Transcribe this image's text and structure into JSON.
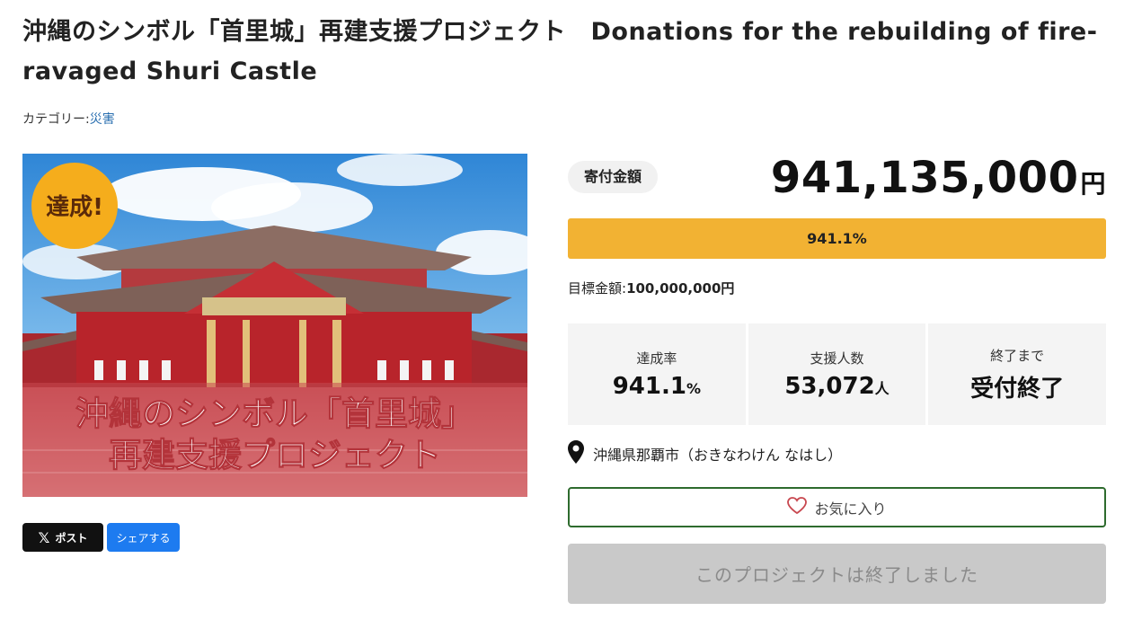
{
  "page": {
    "title": "沖縄のシンボル「首里城」再建支援プロジェクト　Donations for the rebuilding of fire-ravaged Shuri Castle",
    "category_label": "カテゴリー:",
    "category_value": "災害"
  },
  "hero": {
    "badge": "達成!",
    "caption_line1": "沖縄のシンボル「首里城」",
    "caption_line2": "再建支援プロジェクト"
  },
  "share": {
    "x_glyph": "𝕏",
    "x_label": "ポスト",
    "share_label": "シェアする"
  },
  "donation": {
    "badge": "寄付金額",
    "amount": "941,135,000",
    "amount_unit": "円",
    "progress_percent": 941.1,
    "progress_label": "941.1%",
    "goal_label": "目標金額:",
    "goal_value": "100,000,000円"
  },
  "stats": [
    {
      "label": "達成率",
      "value": "941.1",
      "unit": "%"
    },
    {
      "label": "支援人数",
      "value": "53,072",
      "unit": "人"
    },
    {
      "label": "終了まで",
      "value": "受付終了",
      "unit": ""
    }
  ],
  "location": {
    "icon": "map-pin-icon",
    "text": "沖縄県那覇市（おきなわけん なはし）"
  },
  "favorite": {
    "icon": "heart-icon",
    "label": "お気に入り"
  },
  "ended_button": {
    "label": "このプロジェクトは終了しました"
  },
  "colors": {
    "progress": "#f2b233",
    "favorite_border": "#2e6b2e",
    "share_blue": "#1d7bf0",
    "badge_gold": "#f2b233"
  }
}
